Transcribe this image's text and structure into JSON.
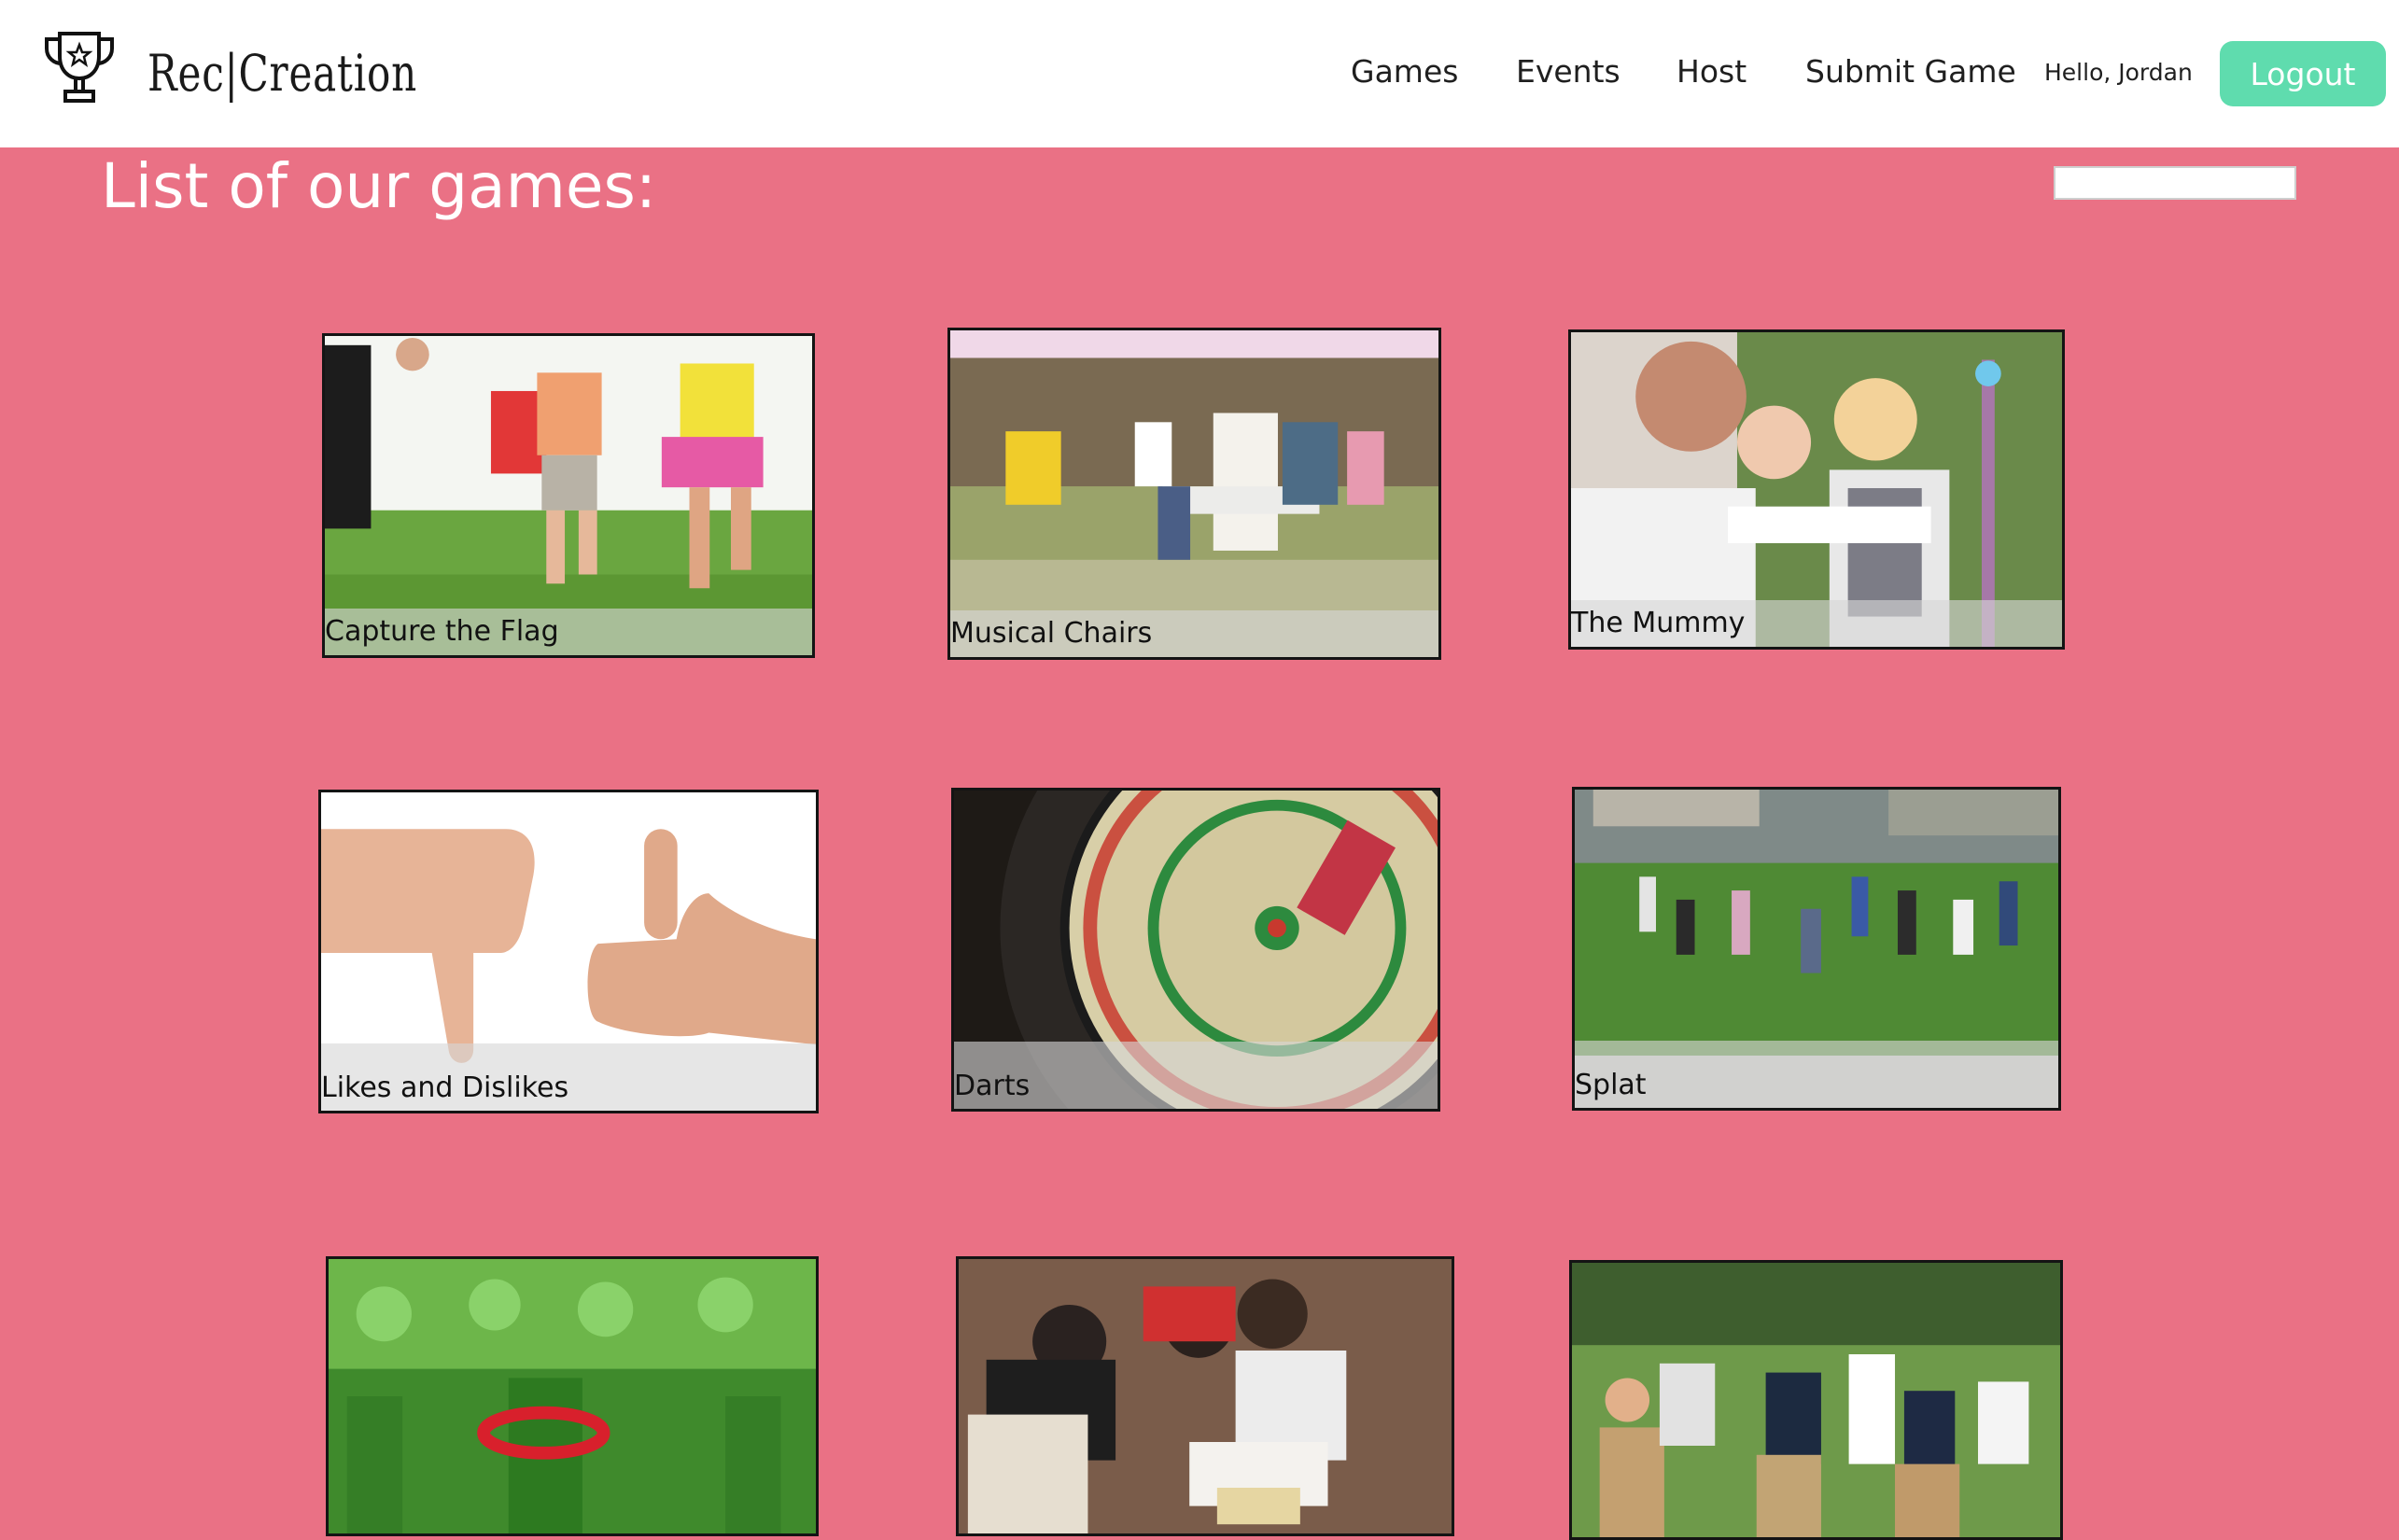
{
  "header": {
    "brand": "Rec|Creation",
    "nav": [
      "Games",
      "Events",
      "Host",
      "Submit Game"
    ],
    "greeting": "Hello, Jordan",
    "logout_label": "Logout"
  },
  "main": {
    "title": "List of our games:",
    "search": {
      "placeholder": "",
      "value": ""
    },
    "games": [
      {
        "name": "Capture the Flag",
        "image": "children-running-on-grass"
      },
      {
        "name": "Musical Chairs",
        "image": "children-playing-musical-chairs"
      },
      {
        "name": "The Mummy",
        "image": "girls-wrapping-with-toilet-paper"
      },
      {
        "name": "Likes and Dislikes",
        "image": "thumbs-down-thumbs-up-hands"
      },
      {
        "name": "Darts",
        "image": "dartboard-with-darts"
      },
      {
        "name": "Splat",
        "image": "group-standing-in-circle-on-lawn"
      },
      {
        "name": "",
        "image": "ring-toss-on-green-bottles"
      },
      {
        "name": "",
        "image": "group-drawing-on-paper-floor"
      },
      {
        "name": "",
        "image": "children-sack-race"
      }
    ]
  },
  "colors": {
    "page_background": "#ea7185",
    "logout_button": "#5fdcae",
    "header_background": "#ffffff"
  }
}
